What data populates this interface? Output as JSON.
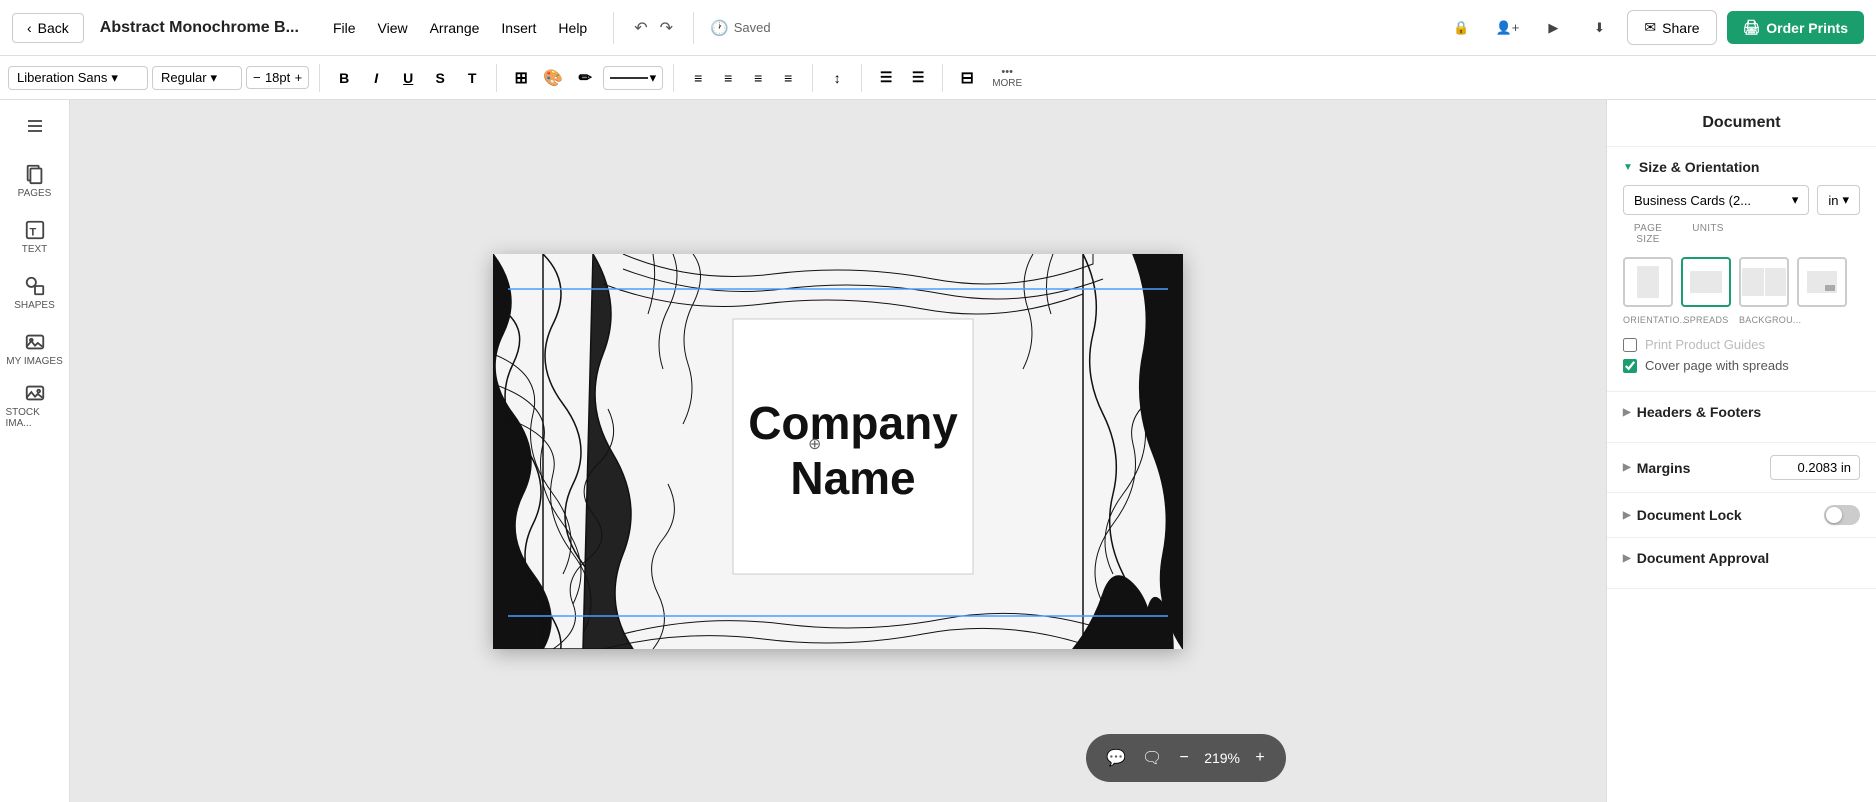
{
  "topbar": {
    "back_label": "Back",
    "title": "Abstract Monochrome B...",
    "menu": [
      "File",
      "View",
      "Arrange",
      "Insert",
      "Help"
    ],
    "saved_label": "Saved",
    "share_label": "Share",
    "order_label": "Order Prints"
  },
  "toolbar": {
    "font_family": "Liberation Sans",
    "font_style": "Regular",
    "font_size": "18pt",
    "bold": "B",
    "italic": "I",
    "underline": "U",
    "strikethrough": "S",
    "transform": "T",
    "more_label": "MORE"
  },
  "sidebar": {
    "items": [
      {
        "label": "PAGES",
        "icon": "pages"
      },
      {
        "label": "TEXT",
        "icon": "text"
      },
      {
        "label": "SHAPES",
        "icon": "shapes"
      },
      {
        "label": "MY IMAGES",
        "icon": "images"
      },
      {
        "label": "STOCK IMA...",
        "icon": "stock"
      }
    ]
  },
  "canvas": {
    "company_line1": "Company",
    "company_line2": "Name"
  },
  "zoom": {
    "value": "219%",
    "minus": "−",
    "plus": "+"
  },
  "panel": {
    "title": "Document",
    "size_orientation": {
      "section_label": "Size & Orientation",
      "page_size_label": "PAGE SIZE",
      "units_label": "UNITS",
      "size_value": "Business Cards (2...",
      "units_value": "in",
      "orientation_label": "ORIENTATIO...",
      "spreads_label": "SPREADS",
      "background_label": "BACKGROU..."
    },
    "print_guides": {
      "label": "Print Product Guides",
      "checked": false
    },
    "cover_spreads": {
      "label": "Cover page with spreads",
      "checked": true
    },
    "headers_footers": {
      "section_label": "Headers & Footers"
    },
    "margins": {
      "section_label": "Margins",
      "value": "0.2083 in"
    },
    "document_lock": {
      "section_label": "Document Lock",
      "toggle_on": false
    },
    "document_approval": {
      "section_label": "Document Approval"
    }
  }
}
